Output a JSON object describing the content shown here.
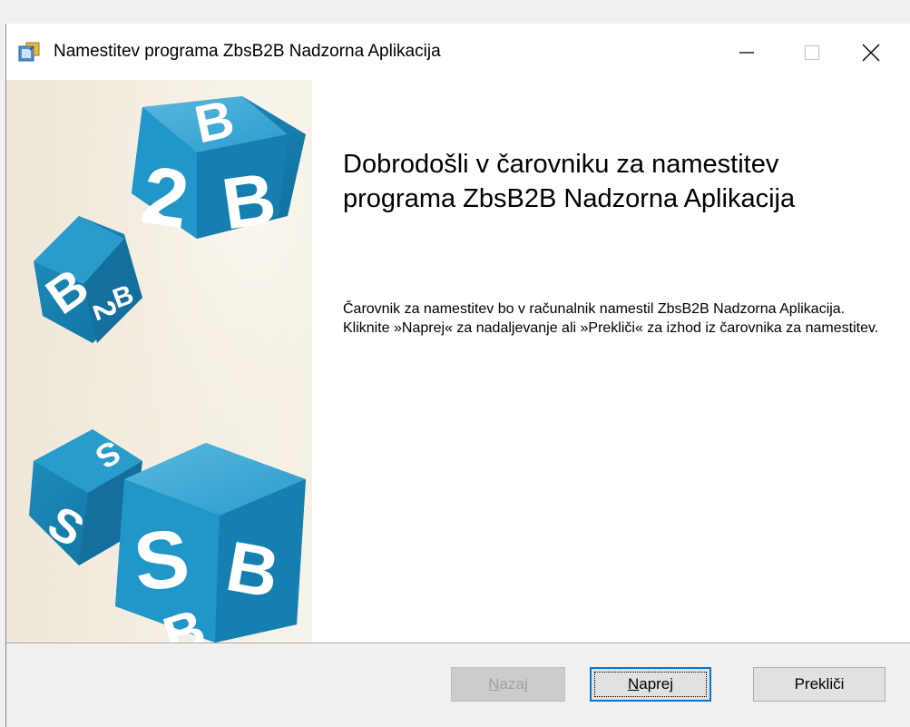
{
  "window": {
    "title": "Namestitev programa ZbsB2B Nadzorna Aplikacija",
    "icon": "installer-icon",
    "controls": {
      "minimize": "minimize-icon",
      "maximize": "maximize-icon",
      "close": "close-icon"
    }
  },
  "banner": {
    "cube_letters": [
      "B",
      "2",
      "B",
      "B",
      "2",
      "B",
      "S",
      "B",
      "B",
      "S"
    ]
  },
  "content": {
    "heading": "Dobrodošli v čarovniku za namestitev programa ZbsB2B Nadzorna Aplikacija",
    "description": "Čarovnik za namestitev bo v računalnik namestil ZbsB2B Nadzorna Aplikacija. Kliknite »Naprej« za nadaljevanje ali »Prekliči« za izhod iz čarovnika za namestitev."
  },
  "footer": {
    "back": {
      "accel": "N",
      "rest": "azaj",
      "enabled": false
    },
    "next": {
      "accel": "N",
      "rest": "aprej",
      "focused": true
    },
    "cancel": {
      "label": "Prekliči"
    }
  },
  "colors": {
    "cube_blue": "#1d8fc0",
    "focus_border": "#0078d7"
  }
}
